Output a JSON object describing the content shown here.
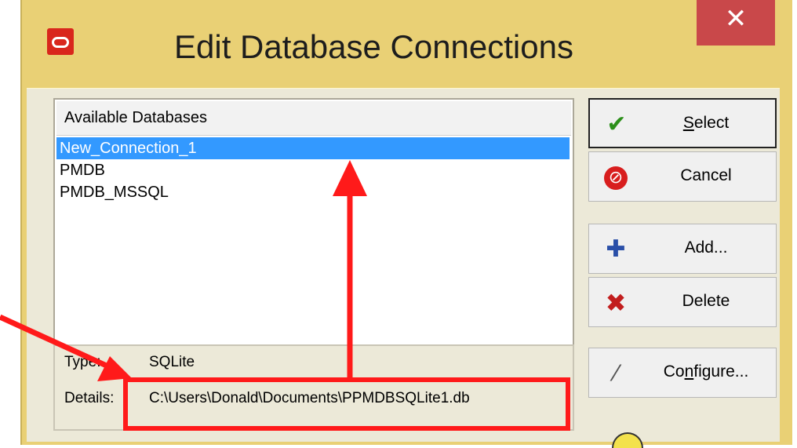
{
  "window": {
    "title": "Edit Database Connections",
    "close_glyph": "✕",
    "logo_icon": "oracle-logo-icon"
  },
  "databases": {
    "header": "Available Databases",
    "items": [
      "New_Connection_1",
      "PMDB",
      "PMDB_MSSQL"
    ],
    "selected_index": 0
  },
  "details": {
    "type_label": "Type:",
    "type_value": "SQLite",
    "details_label": "Details:",
    "details_value": "C:\\Users\\Donald\\Documents\\PPMDBSQLite1.db"
  },
  "buttons": {
    "select": "Select",
    "cancel": "Cancel",
    "add": "Add...",
    "delete": "Delete",
    "configure": "Configure..."
  },
  "icons": {
    "select": "checkmark-icon",
    "cancel": "stop-icon",
    "add": "plus-icon",
    "delete": "x-icon",
    "configure": "magic-wand-icon"
  },
  "colors": {
    "window_frame": "#e9d075",
    "close_button": "#c9484a",
    "selection": "#3399ff",
    "annotation": "#ff1a1a"
  }
}
